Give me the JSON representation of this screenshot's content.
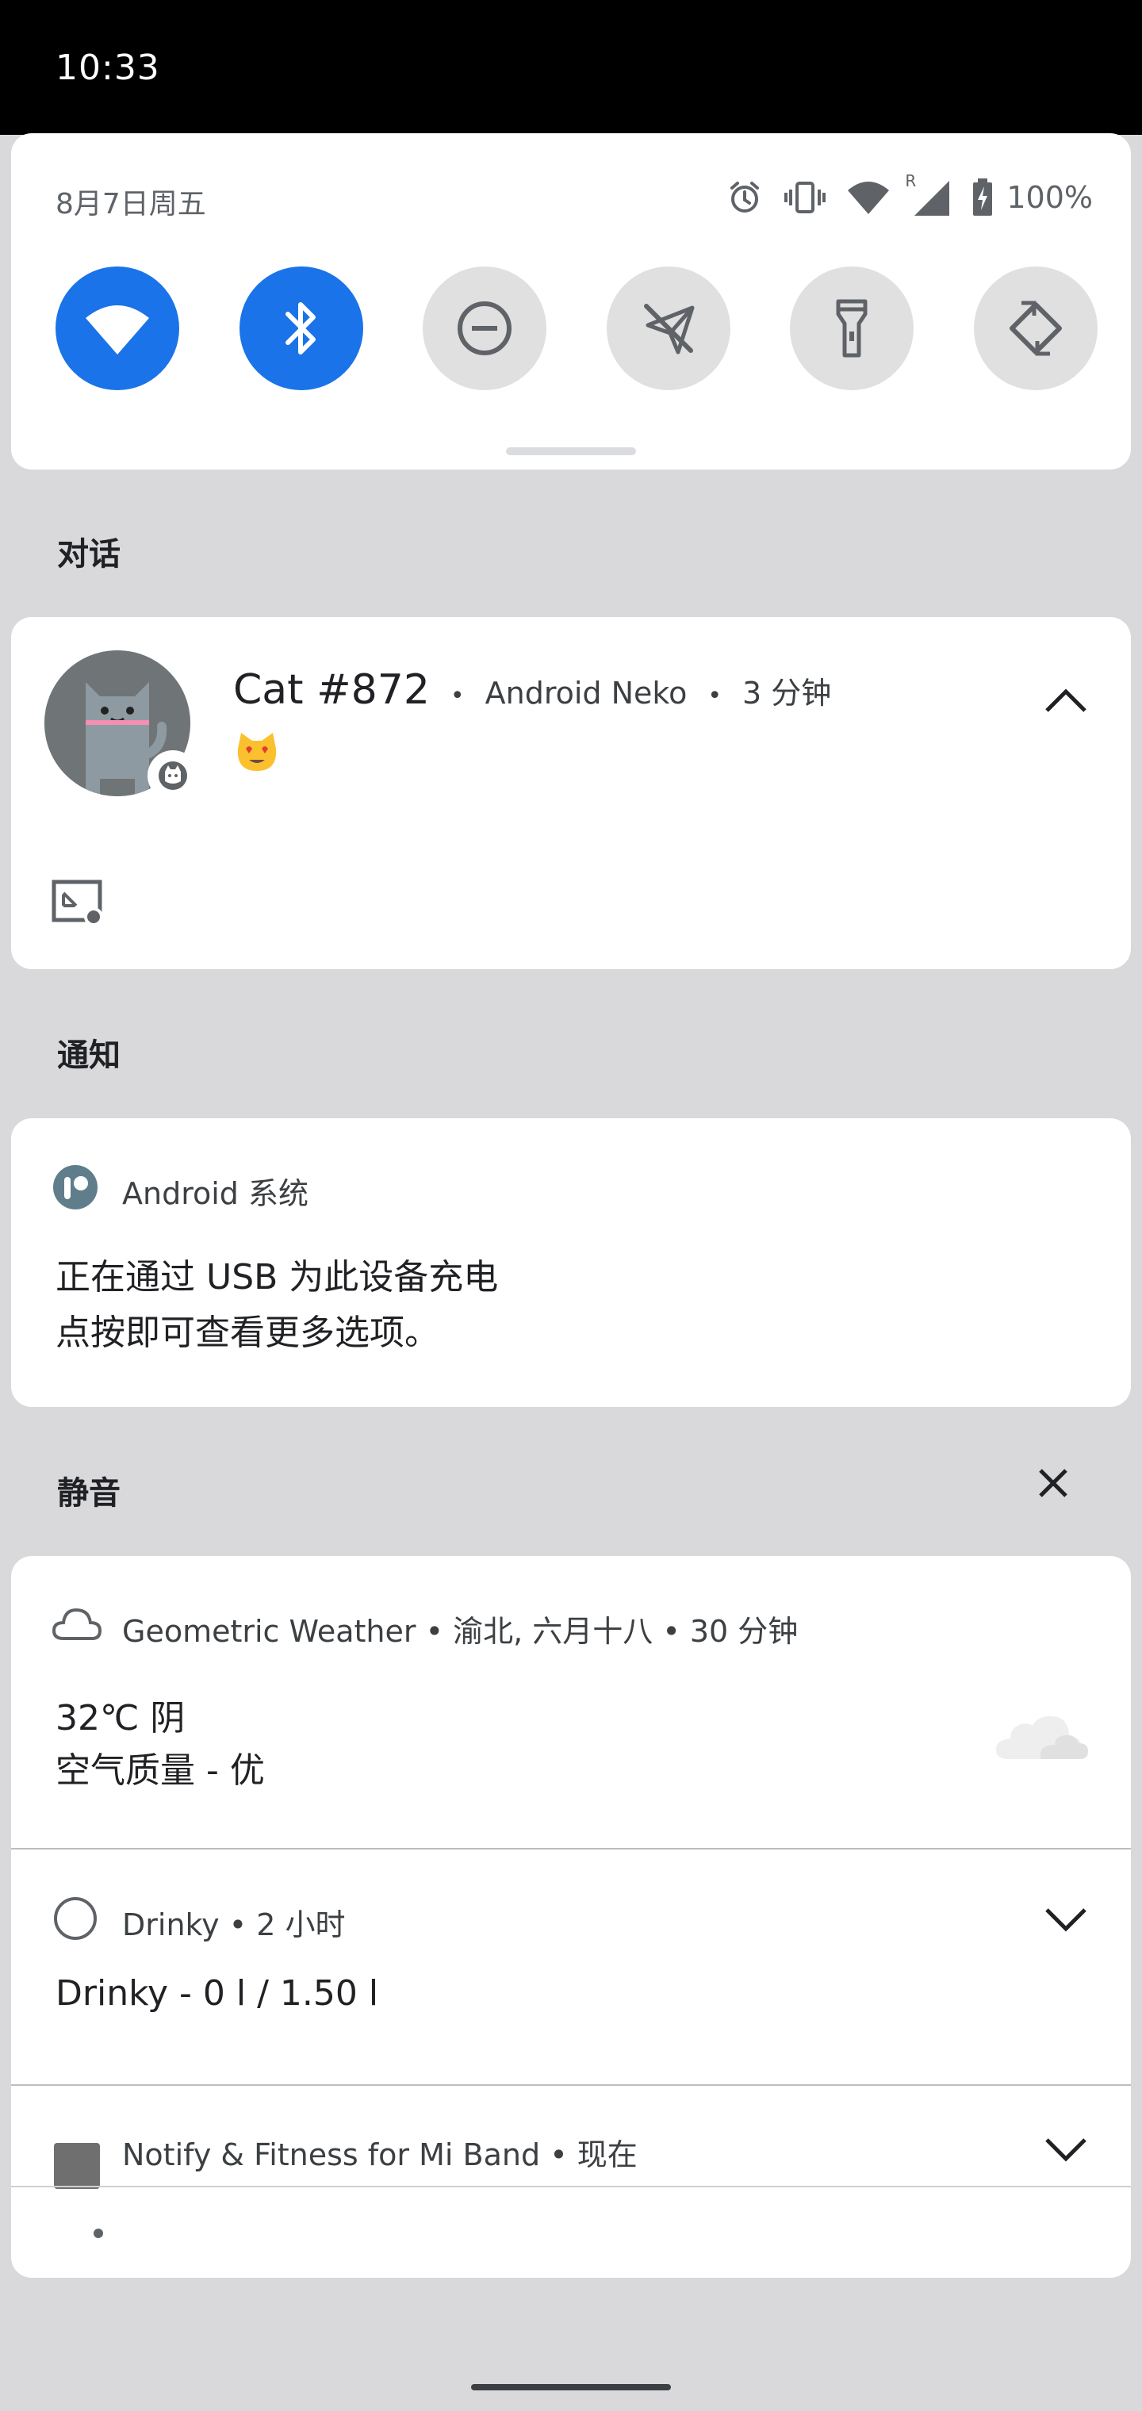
{
  "status_bar": {
    "time": "10:33"
  },
  "quick_settings": {
    "date": "8月7日周五",
    "battery_text": "100%",
    "signal_label": "R",
    "tiles": [
      {
        "name": "wifi",
        "on": true
      },
      {
        "name": "bluetooth",
        "on": true
      },
      {
        "name": "do-not-disturb",
        "on": false
      },
      {
        "name": "airplane-mode",
        "on": false
      },
      {
        "name": "flashlight",
        "on": false
      },
      {
        "name": "auto-rotate",
        "on": false
      }
    ]
  },
  "sections": {
    "conversations": "对话",
    "notifications": "通知",
    "silent": "静音"
  },
  "conversation": {
    "title": "Cat #872",
    "app": "Android Neko",
    "time": "3 分钟",
    "separator": "•",
    "emoji": "😻"
  },
  "system_notification": {
    "app": "Android 系统",
    "title": "正在通过 USB 为此设备充电",
    "text": "点按即可查看更多选项。"
  },
  "silent_notifications": [
    {
      "header": "Geometric Weather • 渝北, 六月十八 • 30 分钟",
      "title": "32℃ 阴",
      "text": "空气质量 - 优"
    },
    {
      "header": "Drinky • 2 小时",
      "title": "Drinky - 0 l / 1.50 l"
    },
    {
      "header": "Notify & Fitness for Mi Band • 现在"
    }
  ],
  "colors": {
    "accent": "#1a73e8",
    "tile_off": "#e0e0e0",
    "background": "#d9d9db"
  }
}
